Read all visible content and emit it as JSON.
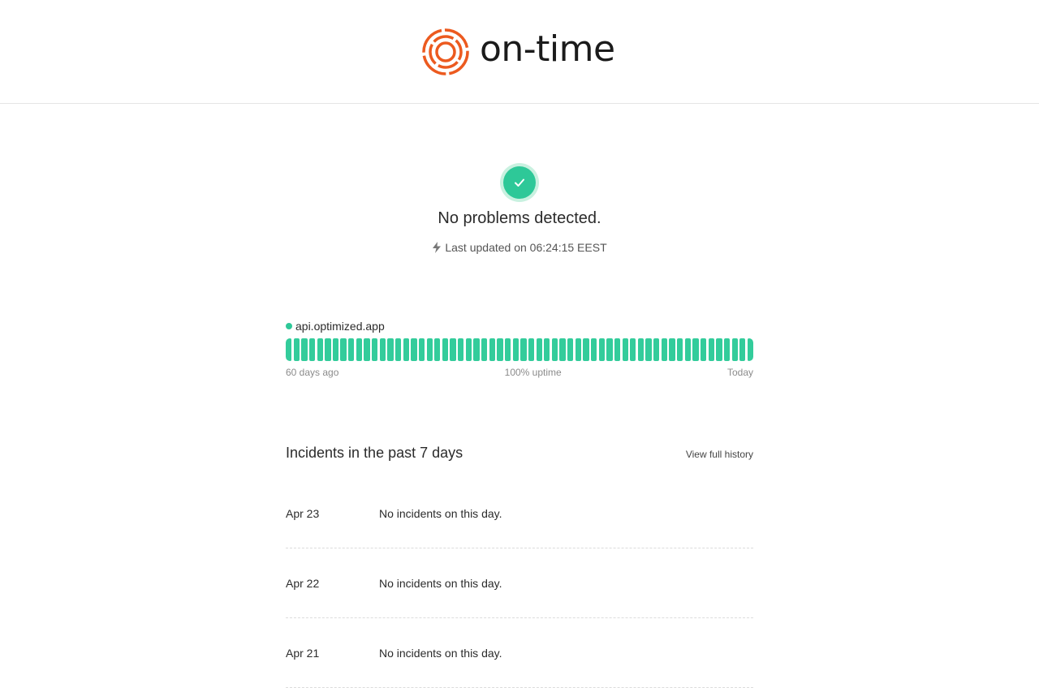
{
  "brand": {
    "name": "on-time",
    "color": "#ec5a1f"
  },
  "status": {
    "title": "No problems detected.",
    "updated": "Last updated on 06:24:15 EEST",
    "color": "#2ec898"
  },
  "service": {
    "name": "api.optimized.app",
    "uptime_label": "100% uptime",
    "uptime_percent": 100,
    "range_start": "60 days ago",
    "range_end": "Today",
    "days_shown": 60
  },
  "incidents": {
    "title": "Incidents in the past 7 days",
    "history_link": "View full history",
    "days": [
      {
        "date": "Apr 23",
        "text": "No incidents on this day."
      },
      {
        "date": "Apr 22",
        "text": "No incidents on this day."
      },
      {
        "date": "Apr 21",
        "text": "No incidents on this day."
      }
    ]
  }
}
